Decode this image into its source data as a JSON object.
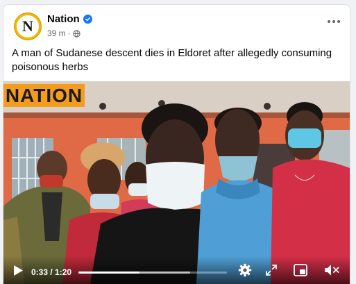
{
  "post": {
    "page_name": "Nation",
    "avatar_letter": "N",
    "time_ago": "39 m",
    "dot": "·",
    "caption": "A man of Sudanese descent dies in Eldoret after allegedly consuming poisonous herbs"
  },
  "video": {
    "watermark": "NATION",
    "current_time": "0:33",
    "separator": " / ",
    "duration": "1:20",
    "progress_fraction": 0.4125,
    "buffered_fraction": 0.75
  },
  "icons": {
    "verified": "verified-badge-icon",
    "privacy": "globe-icon",
    "more": "more-options-icon",
    "play": "play-icon",
    "settings": "gear-icon",
    "fullscreen": "fullscreen-icon",
    "pip": "picture-in-picture-icon",
    "mute": "volume-muted-icon"
  },
  "colors": {
    "brand_blue": "#1877f2",
    "nation_orange": "#f39c1e",
    "avatar_yellow": "#f5b800"
  }
}
